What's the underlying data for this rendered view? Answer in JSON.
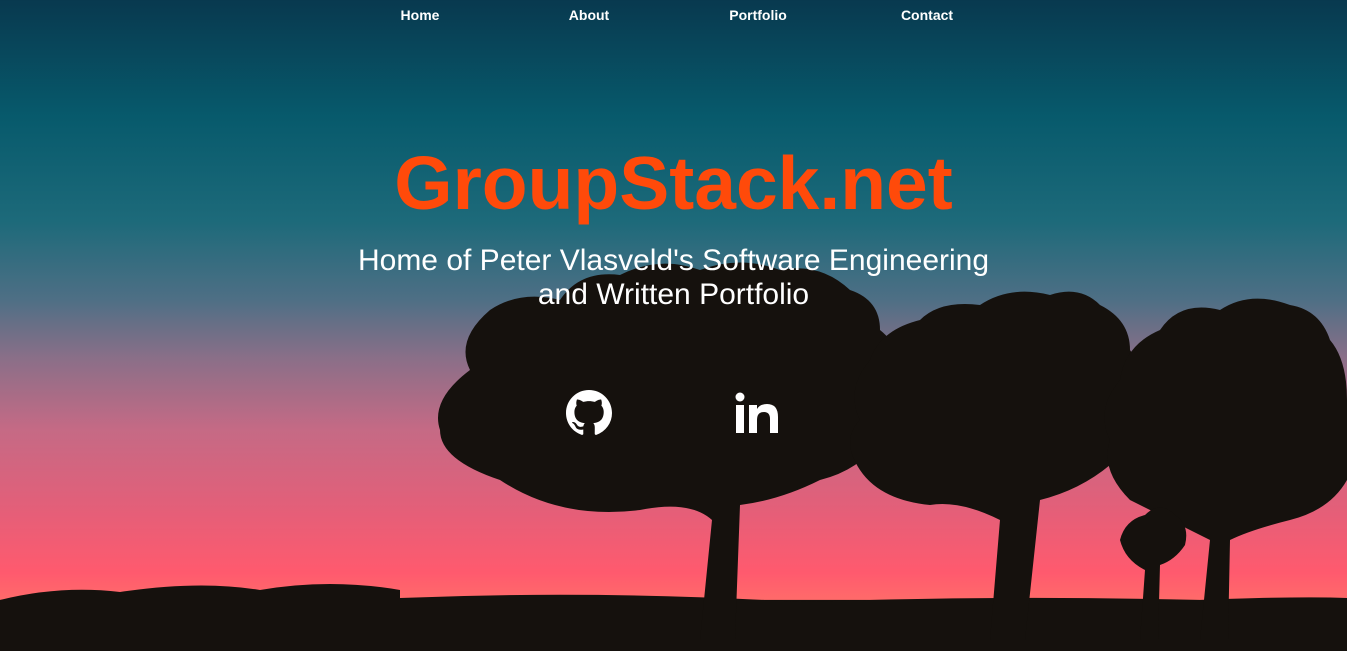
{
  "nav": {
    "items": [
      "Home",
      "About",
      "Portfolio",
      "Contact"
    ]
  },
  "hero": {
    "title": "GroupStack.net",
    "subtitle_line1": "Home of Peter Vlasveld's Software Engineering",
    "subtitle_line2": "and Written Portfolio"
  },
  "social": {
    "github_icon": "github-icon",
    "linkedin_icon": "linkedin-icon"
  },
  "colors": {
    "title": "#ff4a0a",
    "text": "#ffffff"
  }
}
